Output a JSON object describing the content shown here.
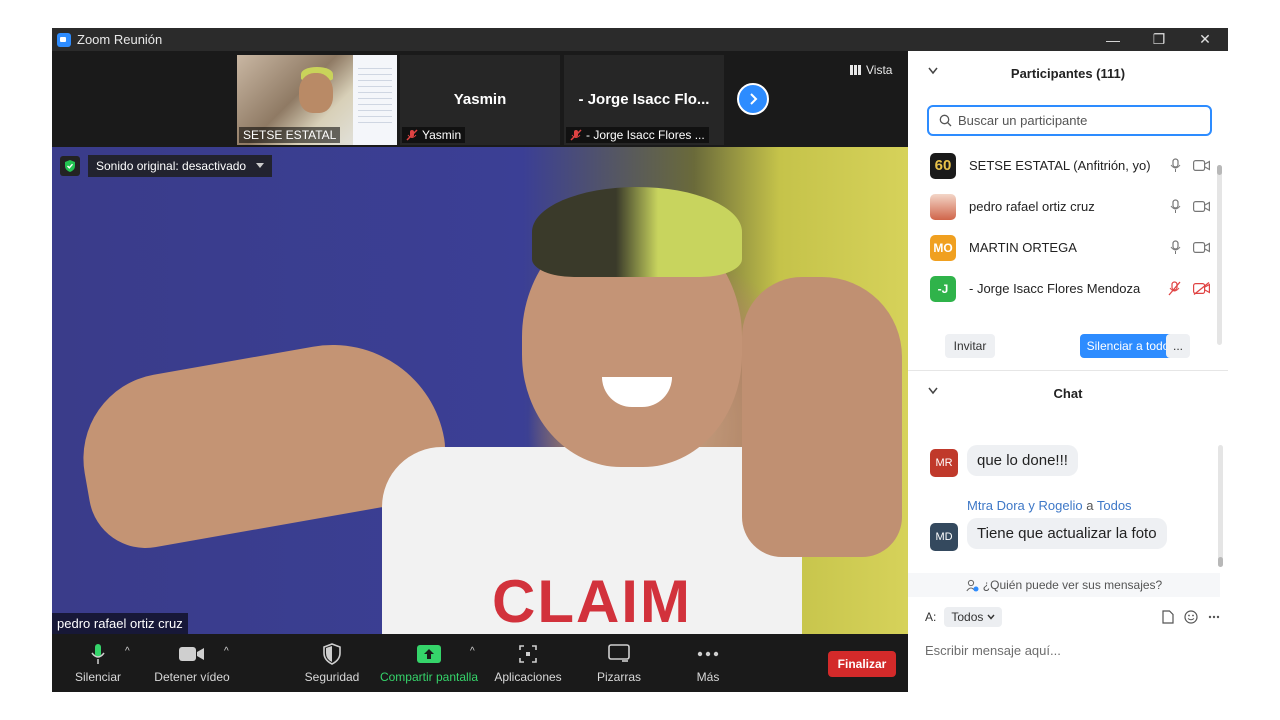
{
  "window": {
    "title": "Zoom Reunión"
  },
  "thumbnails": [
    {
      "label": "SETSE ESTATAL",
      "big_name": "",
      "muted": false
    },
    {
      "label": "Yasmin",
      "big_name": "Yasmin",
      "muted": true
    },
    {
      "label": "- Jorge Isacc Flores ...",
      "big_name": "- Jorge Isacc Flo...",
      "muted": true
    }
  ],
  "view_button": "Vista",
  "main_video": {
    "sound_badge": "Sonido original: desactivado",
    "speaker_name": "pedro rafael ortiz cruz",
    "shirt_logo": "CLAIM"
  },
  "toolbar": {
    "mute": "Silenciar",
    "video": "Detener vídeo",
    "security": "Seguridad",
    "share": "Compartir pantalla",
    "apps": "Aplicaciones",
    "whiteboard": "Pizarras",
    "more": "Más",
    "end": "Finalizar"
  },
  "participants": {
    "header": "Participantes (111)",
    "search_placeholder": "Buscar un participante",
    "list": [
      {
        "name": "SETSE ESTATAL (Anfitrión, yo)",
        "avatar": "60",
        "color": "#1a1a1a",
        "muted": false
      },
      {
        "name": "pedro rafael ortiz cruz",
        "avatar": "",
        "color": "#d98a6a",
        "muted": false
      },
      {
        "name": "MARTIN ORTEGA",
        "avatar": "MO",
        "color": "#f0a020",
        "muted": false
      },
      {
        "name": "- Jorge Isacc Flores Mendoza",
        "avatar": "-J",
        "color": "#2fb34a",
        "muted": true
      }
    ],
    "invite": "Invitar",
    "mute_all": "Silenciar a todos",
    "more": "..."
  },
  "chat": {
    "header": "Chat",
    "messages": [
      {
        "avatar": "MR",
        "color": "#c0392b",
        "text": "que lo done!!!"
      },
      {
        "avatar": "MD",
        "color": "#34495e",
        "sender": "Mtra Dora y Rogelio",
        "to_word": "a",
        "to": "Todos",
        "text": "Tiene que actualizar la foto"
      }
    ],
    "who_sees": "¿Quién puede ver sus mensajes?",
    "to_label": "A:",
    "to_value": "Todos",
    "input_placeholder": "Escribir mensaje aquí..."
  }
}
